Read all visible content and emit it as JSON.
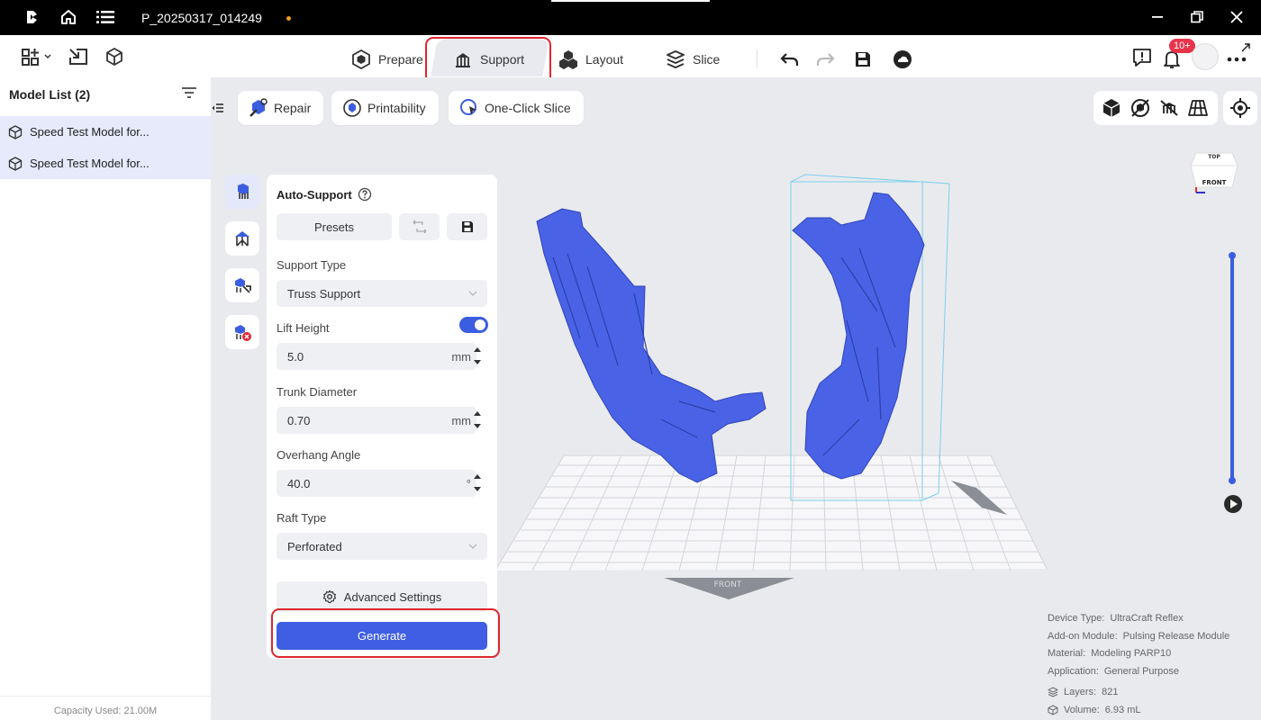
{
  "titlebar": {
    "filename": "P_20250317_014249",
    "unsaved_dot_color": "#f39a1e",
    "icons": [
      "app-logo-icon",
      "home-icon",
      "menu-list-icon",
      "minimize-icon",
      "restore-icon",
      "close-icon"
    ]
  },
  "toolbar": {
    "tabs": [
      {
        "label": "Prepare",
        "icon": "prepare-icon"
      },
      {
        "label": "Support",
        "icon": "support-icon",
        "active": true
      },
      {
        "label": "Layout",
        "icon": "layout-icon"
      },
      {
        "label": "Slice",
        "icon": "slice-icon"
      }
    ],
    "notification_badge": "10+",
    "left_icons": [
      "add-grid-icon",
      "import-icon",
      "model-cube-icon"
    ],
    "right_icons": [
      "undo-icon",
      "redo-icon",
      "save-icon",
      "cloud-icon",
      "feedback-icon",
      "bell-icon",
      "avatar",
      "more-icon"
    ]
  },
  "sidebar": {
    "header": "Model List (2)",
    "items": [
      {
        "label": "Speed Test Model for..."
      },
      {
        "label": "Speed Test Model for..."
      }
    ],
    "capacity": "Capacity Used: 21.00M"
  },
  "viewport_toolbar": {
    "buttons": [
      {
        "label": "Repair",
        "icon": "repair-icon"
      },
      {
        "label": "Printability",
        "icon": "printability-icon"
      },
      {
        "label": "One-Click Slice",
        "icon": "one-click-slice-icon"
      }
    ],
    "view_icons": [
      "solid-view-icon",
      "transparent-view-icon",
      "hide-support-icon",
      "grid-view-icon",
      "locate-icon"
    ]
  },
  "panel": {
    "title": "Auto-Support",
    "presets_label": "Presets",
    "support_type_label": "Support Type",
    "support_type_value": "Truss Support",
    "lift_height_label": "Lift Height",
    "lift_height_enabled": true,
    "lift_height_value": "5.0",
    "lift_height_unit": "mm",
    "trunk_diameter_label": "Trunk Diameter",
    "trunk_diameter_value": "0.70",
    "trunk_diameter_unit": "mm",
    "overhang_angle_label": "Overhang Angle",
    "overhang_angle_value": "40.0",
    "overhang_angle_unit": "°",
    "raft_type_label": "Raft Type",
    "raft_type_value": "Perforated",
    "advanced_label": "Advanced Settings",
    "generate_label": "Generate"
  },
  "scene": {
    "plate_front_label": "FRONT",
    "cube_top_label": "TOP",
    "cube_front_label": "FRONT",
    "model_color": "#4a62e6",
    "accent": "#3f5ee3"
  },
  "info": {
    "device_type_key": "Device Type:",
    "device_type_value": "UltraCraft Reflex",
    "addon_key": "Add-on Module:",
    "addon_value": "Pulsing Release Module",
    "material_key": "Material:",
    "material_value": "Modeling PARP10",
    "application_key": "Application:",
    "application_value": "General Purpose",
    "layers_key": "Layers:",
    "layers_value": "821",
    "volume_key": "Volume:",
    "volume_value": "6.93 mL"
  },
  "highlight_color": "#e0262f"
}
